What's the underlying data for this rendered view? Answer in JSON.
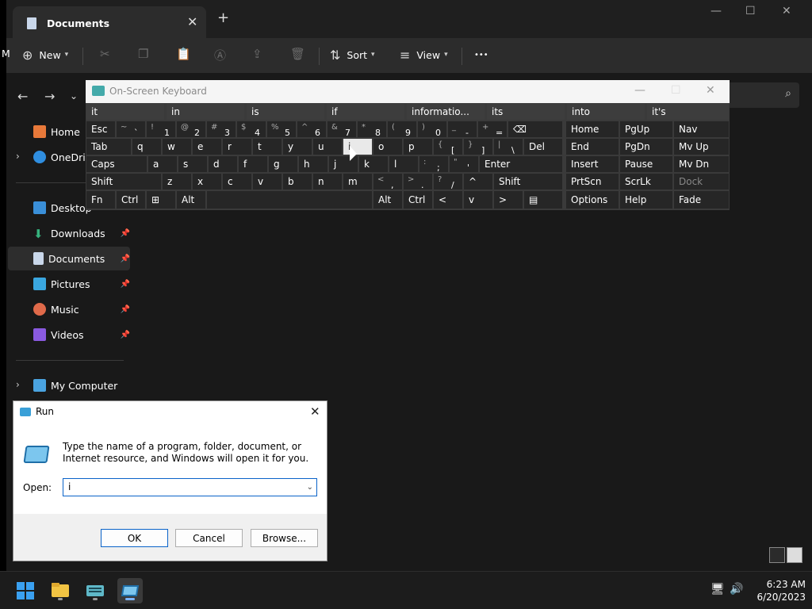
{
  "explorer": {
    "tab_title": "Documents",
    "cut_letter": "M",
    "commands": {
      "new": "New",
      "sort": "Sort",
      "view": "View",
      "more": "•••"
    },
    "sidebar": [
      {
        "label": "Home",
        "color": "#e8793a"
      },
      {
        "label": "OneDrive",
        "color": "#2f8ee0"
      },
      {
        "label": "Desktop",
        "color": "#3a8fd8"
      },
      {
        "label": "Downloads",
        "color": "#36b37e"
      },
      {
        "label": "Documents",
        "color": "#c9d7ea"
      },
      {
        "label": "Pictures",
        "color": "#3aa7e0"
      },
      {
        "label": "Music",
        "color": "#e06a4a"
      },
      {
        "label": "Videos",
        "color": "#8a5ae0"
      },
      {
        "label": "My Computer",
        "color": "#4aa3e0"
      }
    ]
  },
  "osk": {
    "title": "On-Screen Keyboard",
    "predictions": [
      "it",
      "in",
      "is",
      "if",
      "informatio...",
      "its",
      "into",
      "it's"
    ],
    "row1": [
      "Esc"
    ],
    "num_keys": [
      {
        "s": "~",
        "n": "`"
      },
      {
        "s": "!",
        "n": "1"
      },
      {
        "s": "@",
        "n": "2"
      },
      {
        "s": "#",
        "n": "3"
      },
      {
        "s": "$",
        "n": "4"
      },
      {
        "s": "%",
        "n": "5"
      },
      {
        "s": "^",
        "n": "6"
      },
      {
        "s": "&",
        "n": "7"
      },
      {
        "s": "*",
        "n": "8"
      },
      {
        "s": "(",
        "n": "9"
      },
      {
        "s": ")",
        "n": "0"
      },
      {
        "s": "_",
        "n": "-"
      },
      {
        "s": "+",
        "n": "="
      }
    ],
    "row2": [
      "Tab",
      "q",
      "w",
      "e",
      "r",
      "t",
      "y",
      "u",
      "i",
      "o",
      "p"
    ],
    "bracket_keys": [
      {
        "s": "{",
        "n": "["
      },
      {
        "s": "}",
        "n": "]"
      },
      {
        "s": "|",
        "n": "\\"
      }
    ],
    "del": "Del",
    "row3": [
      "Caps",
      "a",
      "s",
      "d",
      "f",
      "g",
      "h",
      "j",
      "k",
      "l"
    ],
    "semi_keys": [
      {
        "s": ":",
        "n": ";"
      },
      {
        "s": "\"",
        "n": "'"
      }
    ],
    "enter": "Enter",
    "row4": [
      "Shift",
      "z",
      "x",
      "c",
      "v",
      "b",
      "n",
      "m"
    ],
    "punct_keys": [
      {
        "s": "<",
        "n": ","
      },
      {
        "s": ">",
        "n": "."
      },
      {
        "s": "?",
        "n": "/"
      }
    ],
    "up": "^",
    "rshift": "Shift",
    "row5": [
      "Fn",
      "Ctrl",
      "Alt",
      "Alt",
      "Ctrl"
    ],
    "arrows": [
      "<",
      "v",
      ">"
    ],
    "nav": [
      [
        "Home",
        "PgUp",
        "Nav"
      ],
      [
        "End",
        "PgDn",
        "Mv Up"
      ],
      [
        "Insert",
        "Pause",
        "Mv Dn"
      ],
      [
        "PrtScn",
        "ScrLk",
        "Dock"
      ],
      [
        "Options",
        "Help",
        "Fade"
      ]
    ]
  },
  "run": {
    "title": "Run",
    "description": "Type the name of a program, folder, document, or Internet resource, and Windows will open it for you.",
    "open_label": "Open:",
    "open_value": "i",
    "ok": "OK",
    "cancel": "Cancel",
    "browse": "Browse..."
  },
  "taskbar": {
    "time": "6:23 AM",
    "date": "6/20/2023"
  }
}
